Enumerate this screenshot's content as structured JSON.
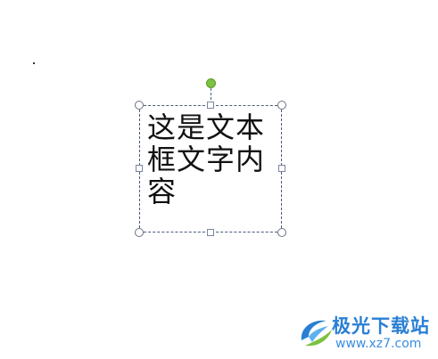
{
  "textbox": {
    "content": "这是文本框文字内容",
    "selected": true
  },
  "watermark": {
    "site_name": "极光下载站",
    "url": "www.xz7.com",
    "logo_icon": "aurora-swirl-icon",
    "colors": {
      "primary": "#2a7fd4",
      "accent": "#7cc242"
    }
  },
  "selection": {
    "rotate_handle_color": "#7cc242",
    "border_color": "#4a5a7a"
  }
}
